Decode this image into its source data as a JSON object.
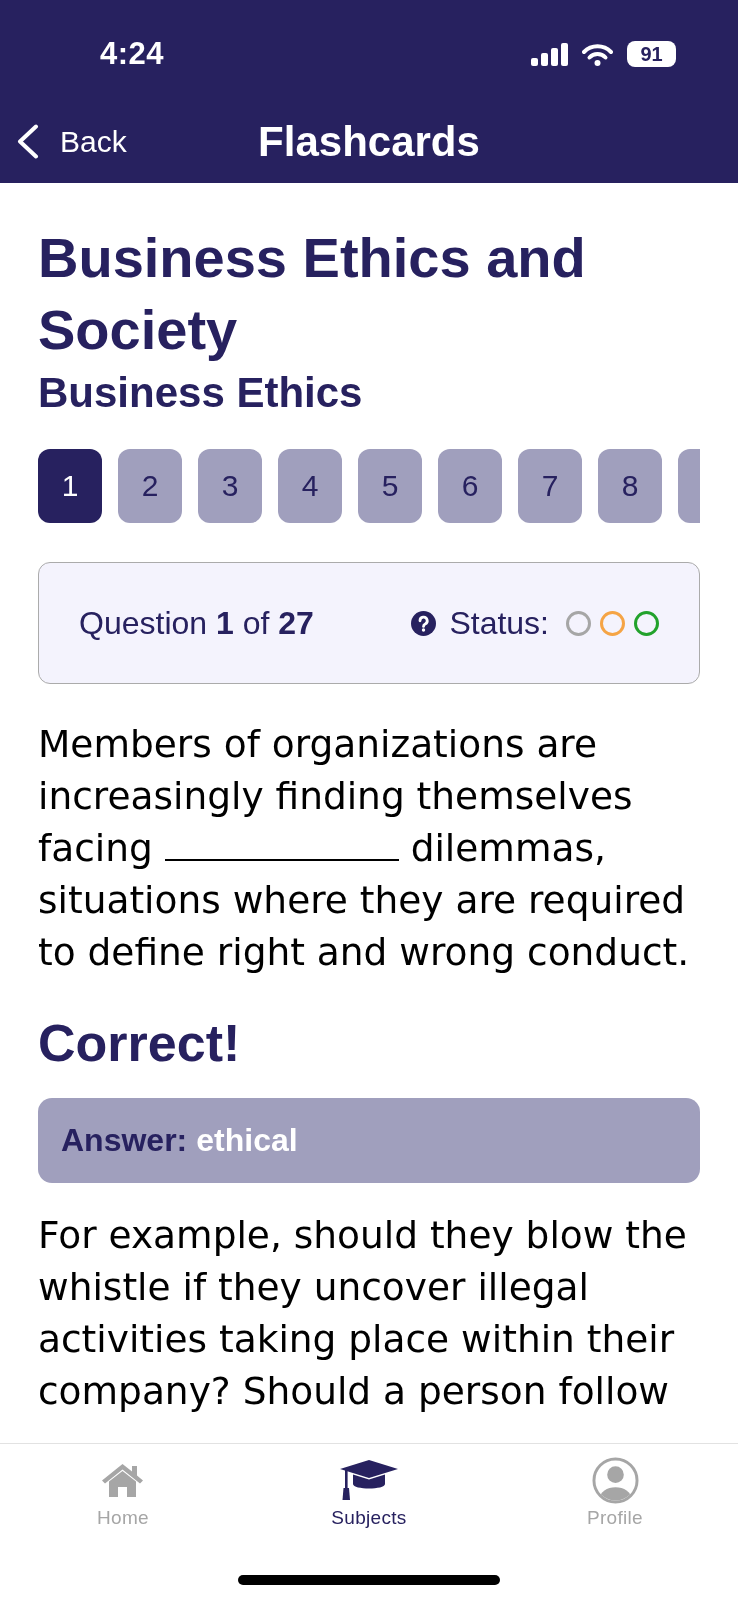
{
  "status_bar": {
    "time": "4:24",
    "battery": "91"
  },
  "nav": {
    "back": "Back",
    "title": "Flashcards"
  },
  "heading": {
    "title": "Business Ethics and Society",
    "subtitle": "Business Ethics"
  },
  "question_tabs": [
    {
      "label": "1",
      "selected": true
    },
    {
      "label": "2",
      "selected": false
    },
    {
      "label": "3",
      "selected": false
    },
    {
      "label": "4",
      "selected": false
    },
    {
      "label": "5",
      "selected": false
    },
    {
      "label": "6",
      "selected": false
    },
    {
      "label": "7",
      "selected": false
    },
    {
      "label": "8",
      "selected": false
    },
    {
      "selected": false
    }
  ],
  "progress": {
    "counter": "Question **1** of **27**",
    "status_label": "Status:",
    "status_marks": [
      {
        "color": "#a6a6a6"
      },
      {
        "color": "#f5a445"
      },
      {
        "color": "#22a22c"
      }
    ]
  },
  "question": [
    {
      "kind": "text",
      "text": "Members of organizations are increasingly finding themselves facing"
    },
    {
      "kind": "blank"
    },
    {
      "kind": "text",
      "text": "dilemmas, situations where they are required to define right and wrong conduct."
    }
  ],
  "result": "Correct!",
  "answer": {
    "label": "Answer:",
    "value": "ethical"
  },
  "explanation": "For example, should they blow the whistle if they uncover illegal activities taking place within their company? Should a person follow",
  "tab_bar": [
    {
      "label": "Home",
      "selected": false
    },
    {
      "label": "Subjects",
      "selected": true
    },
    {
      "label": "Profile",
      "selected": false
    }
  ]
}
